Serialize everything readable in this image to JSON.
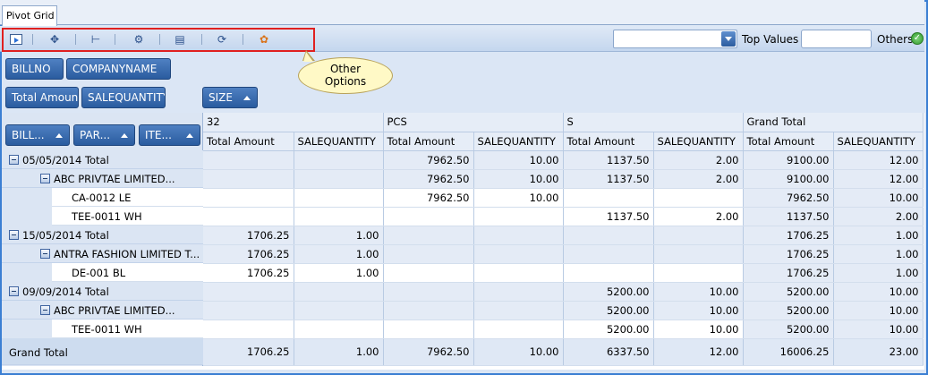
{
  "tab": {
    "label": "Pivot Grid"
  },
  "toolbar": {
    "buttons": [
      "export-icon",
      "expand-icon",
      "hierarchy-icon",
      "settings-icon",
      "report-icon",
      "refresh-icon",
      "options-icon"
    ],
    "top_values_label": "Top Values",
    "top_values_input": "",
    "top_values_select": "",
    "others_label": "Others"
  },
  "callout": {
    "line1": "Other",
    "line2": "Options"
  },
  "filter_fields": [
    "BILLNO",
    "COMPANYNAME"
  ],
  "data_fields": [
    "Total Amount",
    "SALEQUANTITY"
  ],
  "column_field": "SIZE",
  "row_fields": [
    "BILL...",
    "PAR...",
    "ITE..."
  ],
  "grid": {
    "column_groups": [
      "32",
      "PCS",
      "S",
      "Grand Total"
    ],
    "measures": [
      "Total Amount",
      "SALEQUANTITY"
    ],
    "rows": [
      {
        "label": "05/05/2014 Total",
        "level": 0,
        "type": "total",
        "values": [
          "",
          "",
          "7962.50",
          "10.00",
          "1137.50",
          "2.00",
          "9100.00",
          "12.00"
        ]
      },
      {
        "label": "ABC PRIVTAE LIMITED...",
        "level": 1,
        "type": "total",
        "values": [
          "",
          "",
          "7962.50",
          "10.00",
          "1137.50",
          "2.00",
          "9100.00",
          "12.00"
        ]
      },
      {
        "label": "CA-0012 LE",
        "level": 2,
        "type": "item",
        "values": [
          "",
          "",
          "7962.50",
          "10.00",
          "",
          "",
          "7962.50",
          "10.00"
        ]
      },
      {
        "label": "TEE-0011 WH",
        "level": 2,
        "type": "item",
        "values": [
          "",
          "",
          "",
          "",
          "1137.50",
          "2.00",
          "1137.50",
          "2.00"
        ]
      },
      {
        "label": "15/05/2014 Total",
        "level": 0,
        "type": "total",
        "values": [
          "1706.25",
          "1.00",
          "",
          "",
          "",
          "",
          "1706.25",
          "1.00"
        ]
      },
      {
        "label": "ANTRA FASHION LIMITED T...",
        "level": 1,
        "type": "total",
        "values": [
          "1706.25",
          "1.00",
          "",
          "",
          "",
          "",
          "1706.25",
          "1.00"
        ]
      },
      {
        "label": "DE-001 BL",
        "level": 2,
        "type": "item",
        "values": [
          "1706.25",
          "1.00",
          "",
          "",
          "",
          "",
          "1706.25",
          "1.00"
        ]
      },
      {
        "label": "09/09/2014 Total",
        "level": 0,
        "type": "total",
        "values": [
          "",
          "",
          "",
          "",
          "5200.00",
          "10.00",
          "5200.00",
          "10.00"
        ]
      },
      {
        "label": "ABC PRIVTAE LIMITED...",
        "level": 1,
        "type": "total",
        "values": [
          "",
          "",
          "",
          "",
          "5200.00",
          "10.00",
          "5200.00",
          "10.00"
        ]
      },
      {
        "label": "TEE-0011 WH",
        "level": 2,
        "type": "item",
        "values": [
          "",
          "",
          "",
          "",
          "5200.00",
          "10.00",
          "5200.00",
          "10.00"
        ]
      }
    ],
    "grand_total": {
      "label": "Grand Total",
      "values": [
        "1706.25",
        "1.00",
        "7962.50",
        "10.00",
        "6337.50",
        "12.00",
        "16006.25",
        "23.00"
      ]
    }
  }
}
